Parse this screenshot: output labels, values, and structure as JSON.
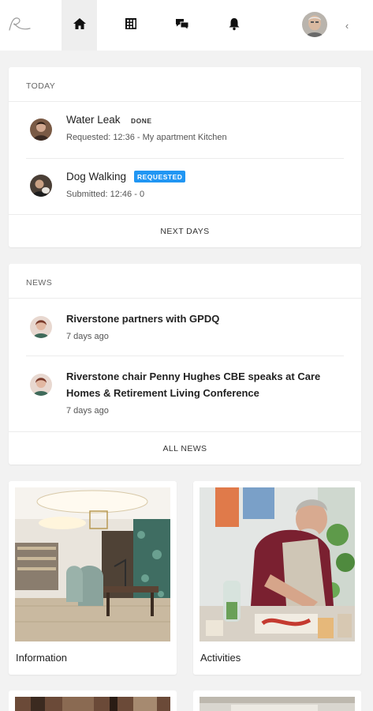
{
  "nav": {
    "items": [
      {
        "name": "home",
        "icon": "home-icon",
        "active": true
      },
      {
        "name": "bills",
        "icon": "building-icon",
        "active": false
      },
      {
        "name": "chat",
        "icon": "chat-bubbles-icon",
        "active": false
      },
      {
        "name": "notifications",
        "icon": "bell-icon",
        "active": false
      }
    ],
    "collapse_glyph": "‹"
  },
  "today": {
    "heading": "TODAY",
    "items": [
      {
        "title": "Water Leak",
        "status": "DONE",
        "subtitle": "Requested: 12:36 - My apartment Kitchen"
      },
      {
        "title": "Dog Walking",
        "status": "REQUESTED",
        "subtitle": "Submitted: 12:46 - 0"
      }
    ],
    "footer": "NEXT DAYS"
  },
  "news": {
    "heading": "NEWS",
    "items": [
      {
        "title": "Riverstone partners with GPDQ",
        "age": "7 days ago"
      },
      {
        "title": "Riverstone chair Penny Hughes CBE speaks at Care Homes & Retirement Living Conference",
        "age": "7 days ago"
      }
    ],
    "footer": "ALL NEWS"
  },
  "tiles": [
    {
      "label": "Information"
    },
    {
      "label": "Activities"
    }
  ],
  "colors": {
    "accent": "#2196f3",
    "background": "#f2f2f2",
    "card": "#ffffff"
  }
}
